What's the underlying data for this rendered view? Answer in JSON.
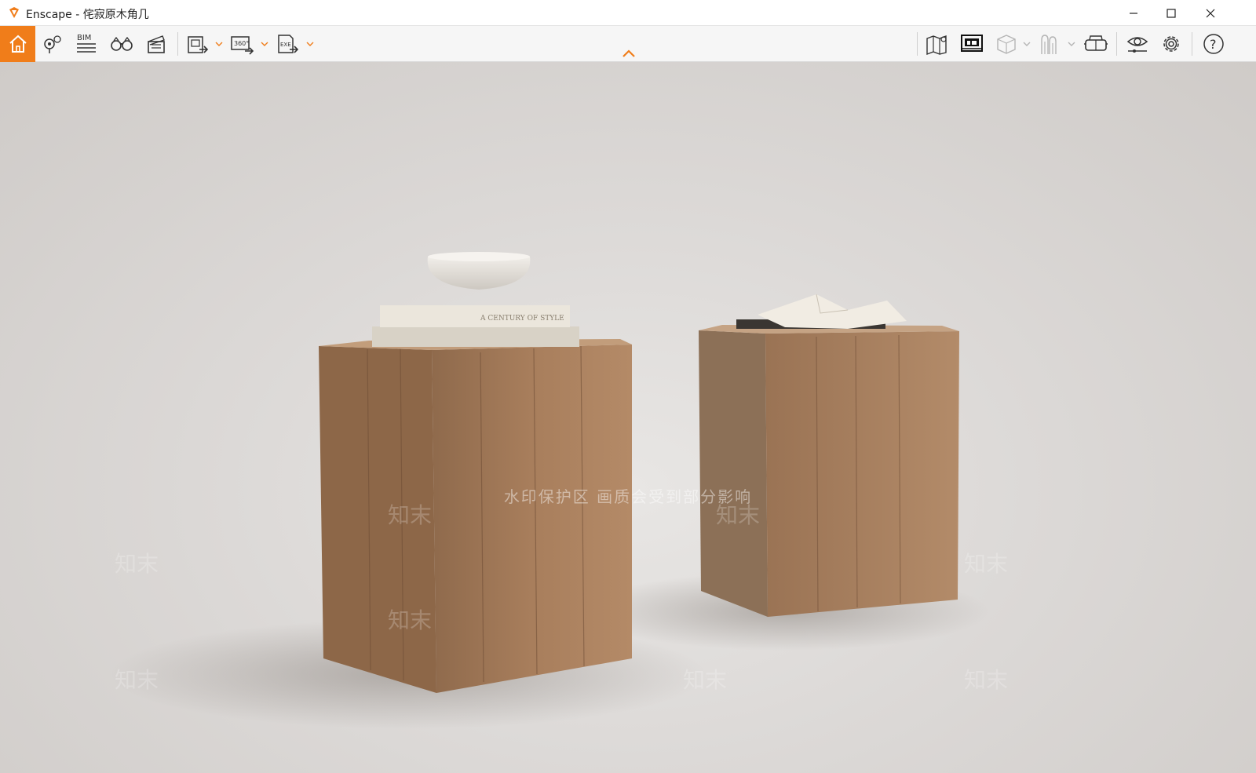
{
  "window": {
    "app_name": "Enscape",
    "title": "Enscape - 侘寂原木角几",
    "controls": [
      "minimize-icon",
      "maximize-icon",
      "close-icon"
    ]
  },
  "toolbar": {
    "left_icons": [
      "home-icon",
      "map-pin-icon",
      "bim-icon",
      "binoculars-icon",
      "clapperboard-icon",
      "export-image-icon",
      "export-360-icon",
      "export-exe-icon"
    ],
    "bim_label": "BIM",
    "export_360_label": "360°",
    "export_exe_label": "EXE",
    "right_icons": [
      "map-book-icon",
      "asset-library-icon",
      "cube-icon",
      "figures-icon",
      "vr-headset-icon",
      "eye-icon",
      "gear-icon",
      "help-icon"
    ],
    "help_label": "?"
  },
  "viewport": {
    "watermark_text": "水印保护区  画质会受到部分影响",
    "watermark_brand": "知末",
    "book_title": "A CENTURY OF STYLE"
  },
  "colors": {
    "accent": "#f07d1a",
    "toolbar_bg": "#f6f6f6",
    "viewport_bg": "#dcd9d7",
    "wood": "#a47a58"
  }
}
